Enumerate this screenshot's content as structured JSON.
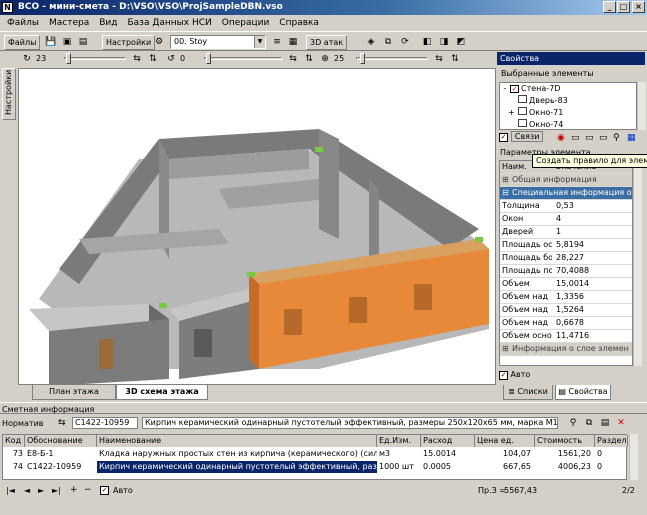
{
  "window": {
    "icon_letter": "N",
    "title": "ВСО - мини-смета - D:\\VSO\\VSO\\ProjSampleDBN.vso",
    "buttons": [
      "_",
      "□",
      "×"
    ]
  },
  "menu": [
    "Файлы",
    "Мастера",
    "Вид",
    "База Данных НСИ",
    "Операции",
    "Справка"
  ],
  "toolbar": {
    "files_label": "Файлы",
    "settings_label": "Настройки",
    "view_combo": "00. Stoy",
    "attack_label": "3D атак"
  },
  "toolbar2": {
    "value1": "23",
    "value2": "0",
    "value3": "25"
  },
  "left_tab": "Настройки",
  "view_tabs": [
    "План этажа",
    "3D схема этажа"
  ],
  "right_panel": {
    "header": "Свойства",
    "selected_label": "Выбранные элементы",
    "tree": [
      {
        "prefix": "-",
        "label": "Стена-7D",
        "checked": true
      },
      {
        "prefix": "",
        "label": "Дверь-83",
        "checked": false
      },
      {
        "prefix": "+",
        "label": "Окно-71",
        "checked": false
      },
      {
        "prefix": "",
        "label": "Окно-74",
        "checked": false
      }
    ],
    "links_label": "Связи",
    "params_label": "Параметры элемента",
    "col_name": "Наим.",
    "col_value": "Значение",
    "sections": {
      "general": "Общая информация",
      "special": "Специальная информация о"
    },
    "rows": [
      {
        "name": "Толщина",
        "value": "0,53"
      },
      {
        "name": "Окон",
        "value": "4"
      },
      {
        "name": "Дверей",
        "value": "1"
      },
      {
        "name": "Площадь ос",
        "value": "5,8194"
      },
      {
        "name": "Площадь бо",
        "value": "28,227"
      },
      {
        "name": "Площадь по",
        "value": "70,4088"
      },
      {
        "name": "Объем",
        "value": "15,0014"
      },
      {
        "name": "Объем над",
        "value": "1,3356"
      },
      {
        "name": "Объем над",
        "value": "1,5264"
      },
      {
        "name": "Объем над",
        "value": "0,6678"
      },
      {
        "name": "Объем осно",
        "value": "11,4716"
      }
    ],
    "extra_section": "Информация о слое элемен",
    "auto_label": "Авто",
    "bottom_tabs": [
      "Списки",
      "Свойства"
    ]
  },
  "tooltip": "Создать правило для элем",
  "estimate": {
    "header": "Сметная информация",
    "norm_label": "Норматив",
    "norm_code": "С1422-10959",
    "norm_desc": "Кирпич керамический одинарный пустотелый эффективный, размеры 250х120х65 мм, марка М125",
    "columns": [
      "Код",
      "Обоснование",
      "Наименование",
      "Ед.Изм.",
      "Расход",
      "Цена ед.",
      "Стоимость",
      "Раздел"
    ],
    "rows": [
      {
        "code": "73",
        "basis": "Е8-Б-1",
        "name": "Кладка наружных простых стен из кирпича (керамического) (силикатного)",
        "unit": "м3",
        "amount": "15.0014",
        "price": "104,07",
        "cost": "1561,20",
        "section": "0"
      },
      {
        "code": "74",
        "basis": "С1422-10959",
        "name": "Кирпич керамический одинарный пустотелый эффективный, размеры",
        "unit": "1000 шт",
        "amount": "0.0005",
        "price": "667,65",
        "cost": "4006,23",
        "section": "0"
      }
    ],
    "auto_label": "Авто",
    "total_label": "Пр.З =",
    "total_value": "5567,43",
    "page": "2/2"
  }
}
